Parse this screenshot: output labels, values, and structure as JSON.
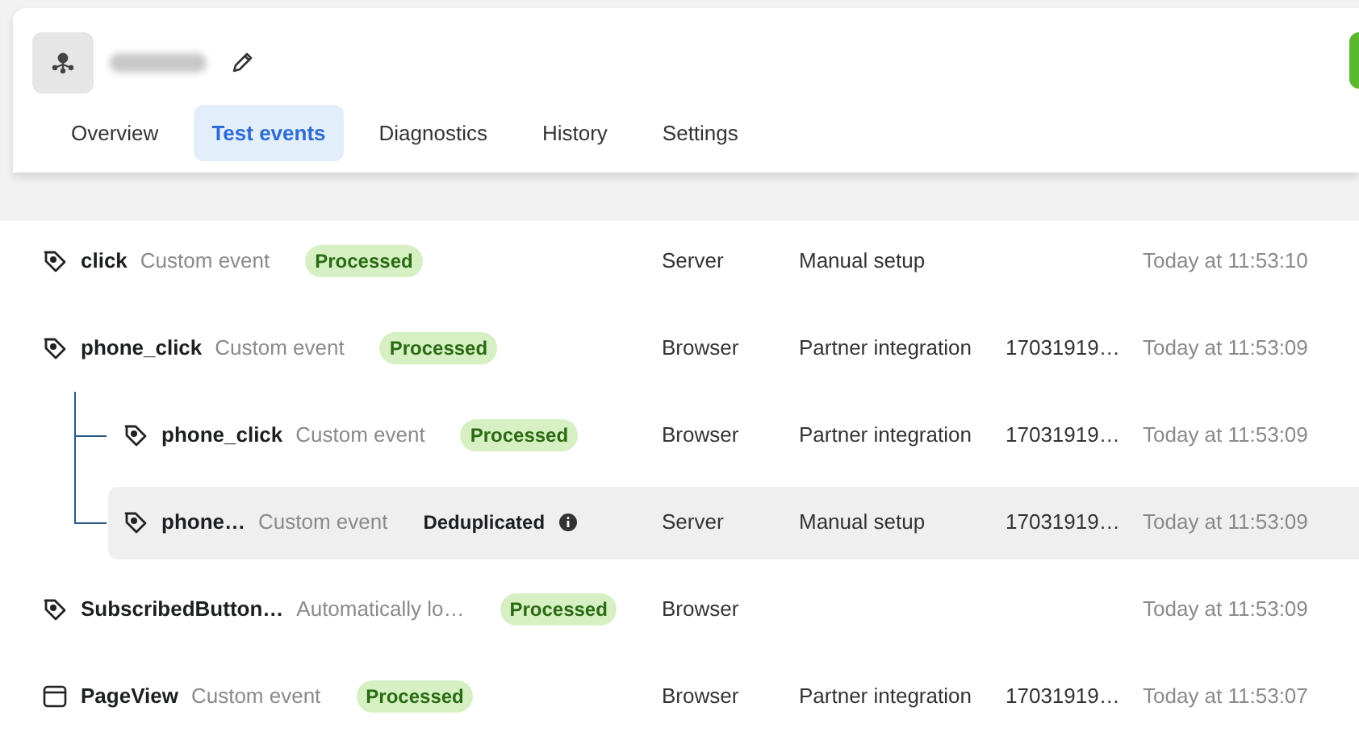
{
  "header": {
    "tabs": [
      {
        "label": "Overview",
        "selected": false
      },
      {
        "label": "Test events",
        "selected": true
      },
      {
        "label": "Diagnostics",
        "selected": false
      },
      {
        "label": "History",
        "selected": false
      },
      {
        "label": "Settings",
        "selected": false
      }
    ]
  },
  "events": [
    {
      "kind": "tag",
      "name": "click",
      "type": "Custom event",
      "status": {
        "kind": "processed",
        "label": "Processed"
      },
      "source": "Server",
      "setup": "Manual setup",
      "time": "Today at 11:53:10",
      "selected": false
    },
    {
      "kind": "tag",
      "name": "phone_click",
      "type": "Custom event",
      "status": {
        "kind": "processed",
        "label": "Processed"
      },
      "source": "Browser",
      "setup": "Partner integration",
      "id": "17031919…",
      "time": "Today at 11:53:09",
      "selected": false,
      "children": [
        {
          "kind": "tag",
          "name": "phone_click",
          "type": "Custom event",
          "status": {
            "kind": "processed",
            "label": "Processed"
          },
          "source": "Browser",
          "setup": "Partner integration",
          "id": "17031919…",
          "time": "Today at 11:53:09",
          "selected": false
        },
        {
          "kind": "tag",
          "name": "phone…",
          "type": "Custom event",
          "status": {
            "kind": "deduplicated",
            "label": "Deduplicated"
          },
          "source": "Server",
          "setup": "Manual setup",
          "id": "17031919…",
          "time": "Today at 11:53:09",
          "selected": true
        }
      ]
    },
    {
      "kind": "tag",
      "name": "SubscribedButton…",
      "type": "Automatically lo…",
      "status": {
        "kind": "processed",
        "label": "Processed"
      },
      "source": "Browser",
      "time": "Today at 11:53:09",
      "selected": false
    },
    {
      "kind": "page",
      "name": "PageView",
      "type": "Custom event",
      "status": {
        "kind": "processed",
        "label": "Processed"
      },
      "source": "Browser",
      "setup": "Partner integration",
      "id": "17031919…",
      "time": "Today at 11:53:07",
      "selected": false
    }
  ]
}
